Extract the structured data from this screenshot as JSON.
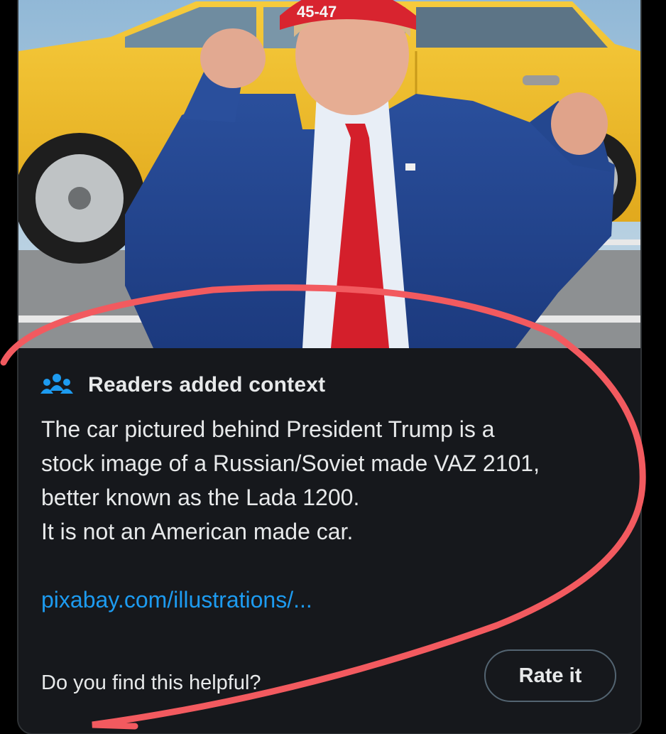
{
  "note": {
    "header": "Readers added context",
    "header_icon": "people-icon",
    "body_lines": [
      "The car pictured behind President Trump is a",
      "stock image of a Russian/Soviet made VAZ 2101,",
      "better known as the Lada 1200.",
      "It is not an American made car."
    ],
    "link_text": "pixabay.com/illustrations/...",
    "helpful_question": "Do you find this helpful?",
    "rate_button_label": "Rate it"
  },
  "image": {
    "hat_text": "45-47",
    "alt": "Man in blue suit and red tie raising fists in front of a yellow car"
  },
  "colors": {
    "background": "#000000",
    "card": "#16181c",
    "text": "#e7e9ea",
    "link": "#1d9bf0",
    "icon": "#1d9bf0",
    "annotation_stroke": "#f25a5f",
    "car": "#f2c230"
  }
}
